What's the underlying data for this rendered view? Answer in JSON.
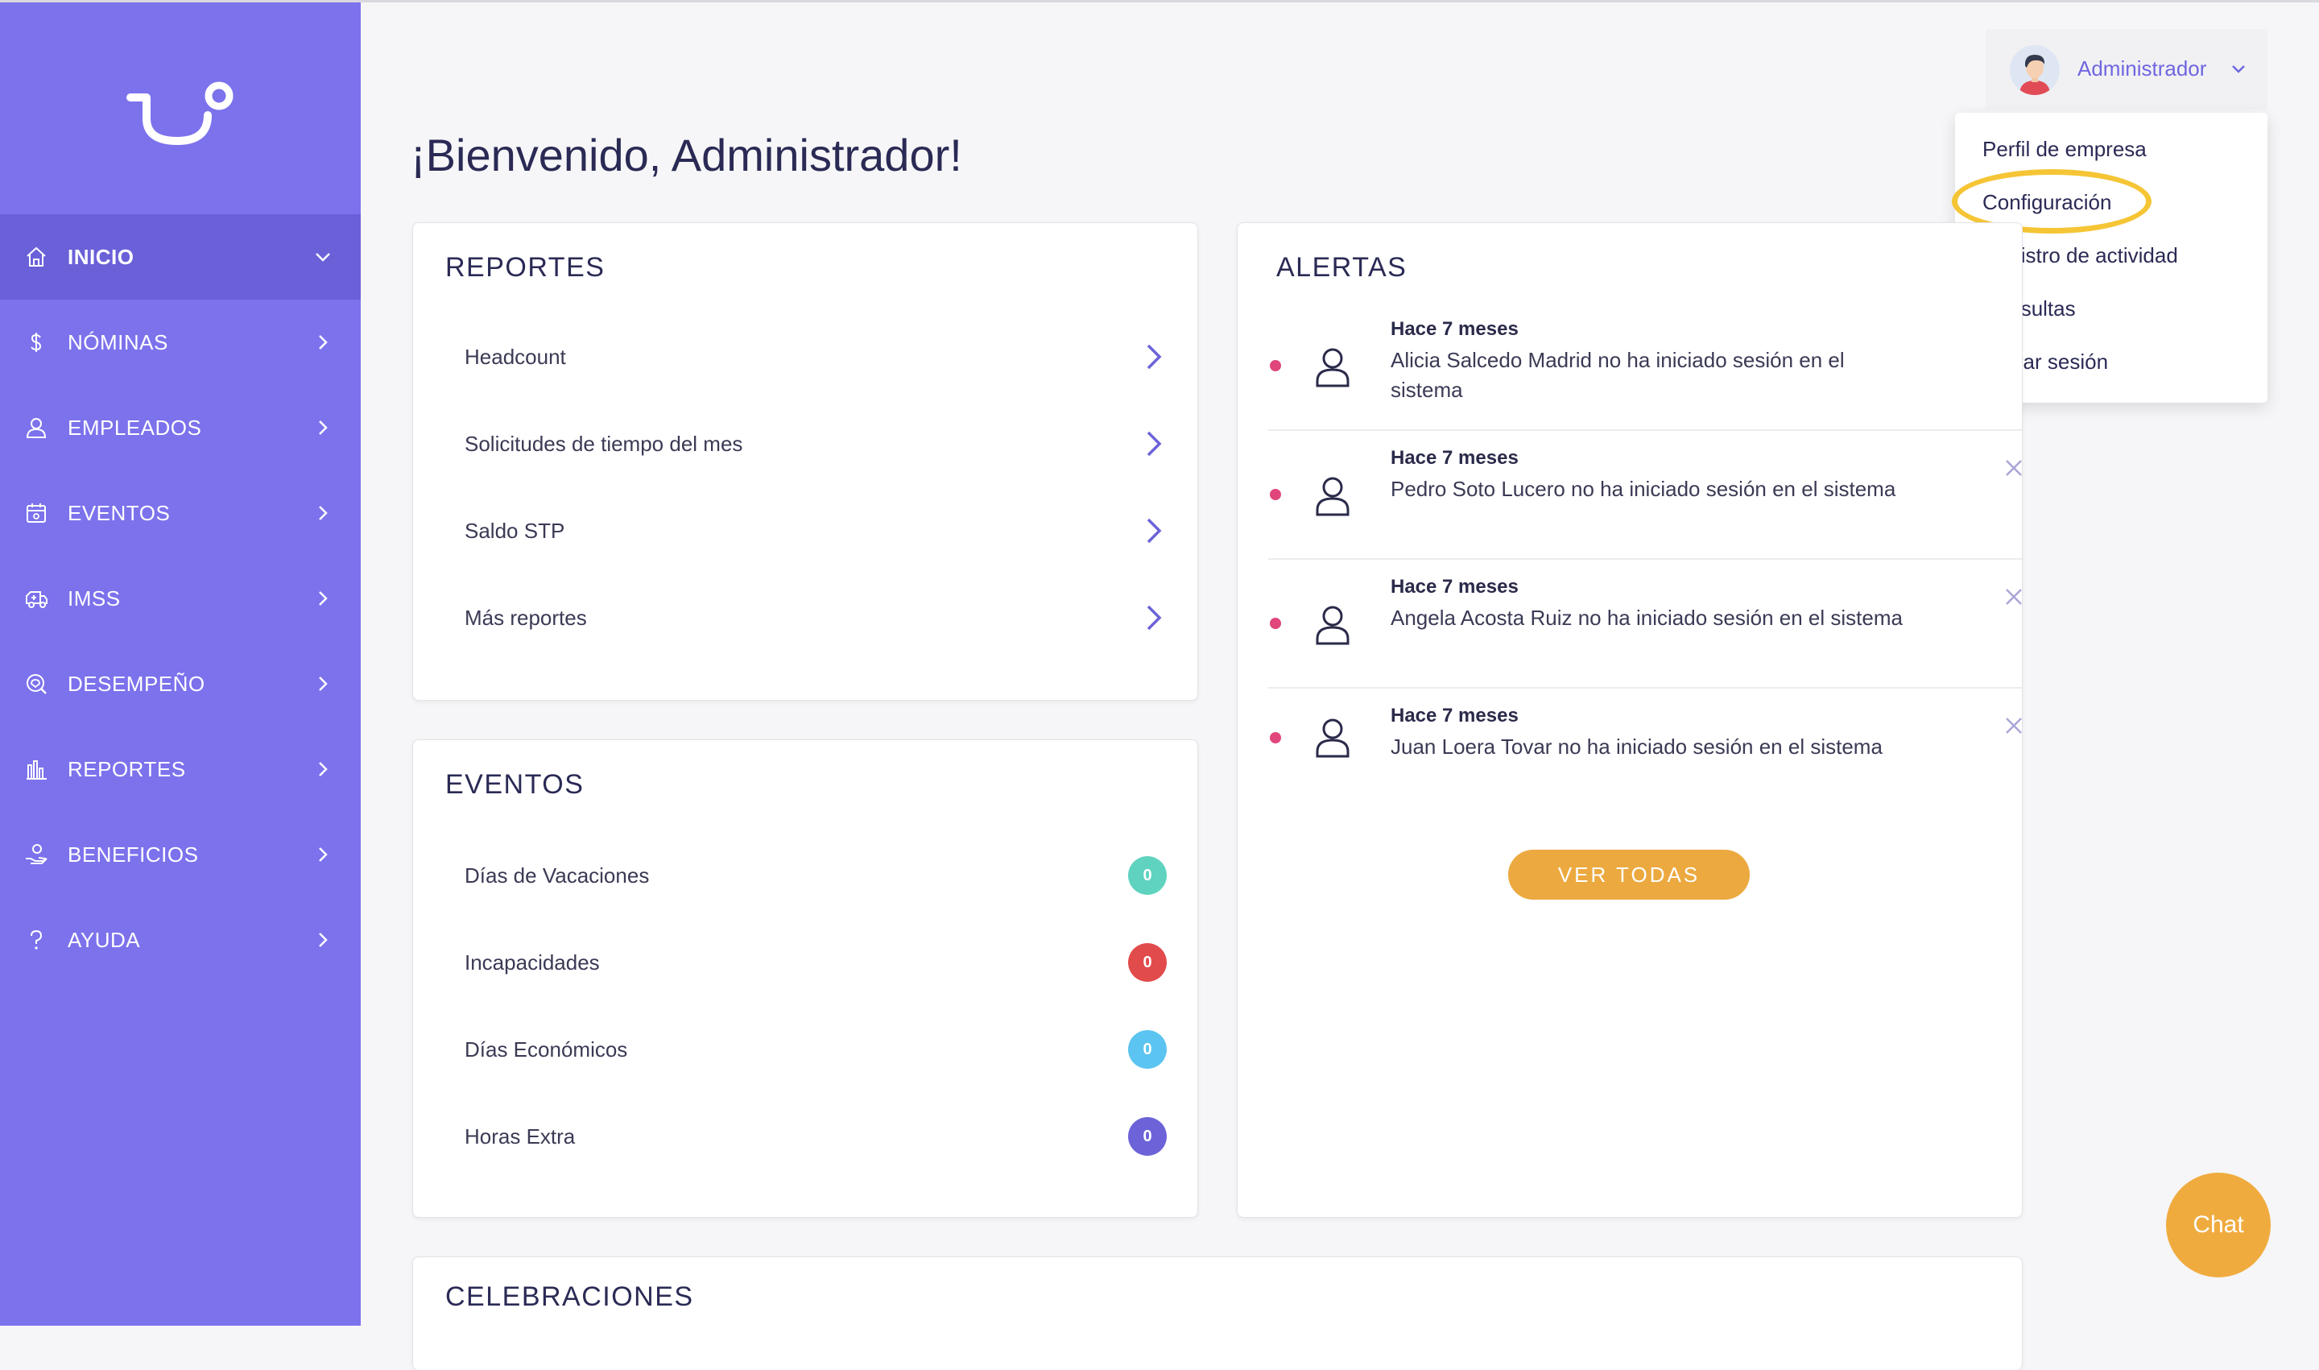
{
  "sidebar": {
    "items": [
      {
        "label": "INICIO",
        "icon": "home-icon",
        "active": true
      },
      {
        "label": "NÓMINAS",
        "icon": "dollar-icon"
      },
      {
        "label": "EMPLEADOS",
        "icon": "user-icon"
      },
      {
        "label": "EVENTOS",
        "icon": "calendar-icon"
      },
      {
        "label": "IMSS",
        "icon": "ambulance-icon"
      },
      {
        "label": "DESEMPEÑO",
        "icon": "performance-icon"
      },
      {
        "label": "REPORTES",
        "icon": "bar-chart-icon"
      },
      {
        "label": "BENEFICIOS",
        "icon": "benefits-icon"
      },
      {
        "label": "AYUDA",
        "icon": "help-icon"
      }
    ]
  },
  "header": {
    "welcome": "¡Bienvenido, Administrador!",
    "user_name": "Administrador"
  },
  "user_menu": {
    "items": [
      "Perfil de empresa",
      "Configuración",
      "Registro de actividad",
      "Consultas",
      "Cerrar sesión"
    ],
    "highlighted": "Configuración",
    "highlight_color": "#f5c535"
  },
  "reportes": {
    "title": "REPORTES",
    "items": [
      "Headcount",
      "Solicitudes de tiempo del mes",
      "Saldo STP",
      "Más reportes"
    ]
  },
  "eventos": {
    "title": "EVENTOS",
    "items": [
      {
        "label": "Días de Vacaciones",
        "count": "0",
        "color": "#5fd3bf"
      },
      {
        "label": "Incapacidades",
        "count": "0",
        "color": "#e24b4b"
      },
      {
        "label": "Días Económicos",
        "count": "0",
        "color": "#5bc4f0"
      },
      {
        "label": "Horas Extra",
        "count": "0",
        "color": "#6c63d8"
      }
    ]
  },
  "alertas": {
    "title": "ALERTAS",
    "items": [
      {
        "time": "Hace 7 meses",
        "message": "Alicia Salcedo Madrid no ha iniciado sesión en el sistema"
      },
      {
        "time": "Hace 7 meses",
        "message": "Pedro Soto Lucero no ha iniciado sesión en el sistema"
      },
      {
        "time": "Hace 7 meses",
        "message": "Angela Acosta Ruiz no ha iniciado sesión en el sistema"
      },
      {
        "time": "Hace 7 meses",
        "message": "Juan Loera Tovar no ha iniciado sesión en el sistema"
      }
    ],
    "button": "VER TODAS"
  },
  "celebraciones": {
    "title": "CELEBRACIONES"
  },
  "chat": {
    "label": "Chat"
  },
  "colors": {
    "sidebar": "#7c72ec",
    "sidebar_active": "#6a60d8",
    "accent": "#6f66e0",
    "button": "#eca93f",
    "alert_dot": "#e0457b"
  }
}
